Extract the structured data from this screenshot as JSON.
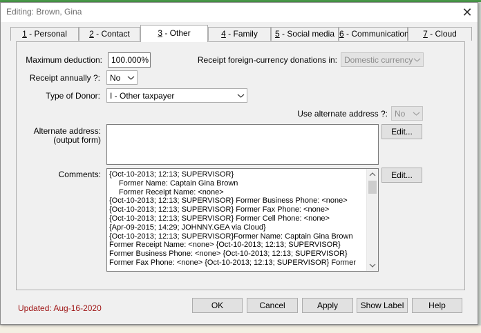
{
  "window": {
    "title": "Editing: Brown, Gina"
  },
  "tabs": [
    {
      "num": "1",
      "label": " - Personal"
    },
    {
      "num": "2",
      "label": " - Contact"
    },
    {
      "num": "3",
      "label": " - Other",
      "active": true
    },
    {
      "num": "4",
      "label": " - Family"
    },
    {
      "num": "5",
      "label": " - Social media"
    },
    {
      "num": "6",
      "label": " - Communication"
    },
    {
      "num": "7",
      "label": " - Cloud"
    }
  ],
  "form": {
    "max_deduction_label": "Maximum deduction:",
    "max_deduction_value": "100.000%",
    "foreign_label": "Receipt foreign-currency donations in:",
    "foreign_value": "Domestic currency",
    "receipt_annually_label": "Receipt annually ?:",
    "receipt_annually_value": "No",
    "donor_type_label": "Type of Donor:",
    "donor_type_value": "I - Other taxpayer",
    "alt_address_use_label": "Use alternate address ?:",
    "alt_address_use_value": "No",
    "alt_address_label_1": "Alternate address:",
    "alt_address_label_2": "(output form)",
    "alt_address_value": "",
    "edit_label": "Edit...",
    "comments_label": "Comments:",
    "comments": [
      "{Oct-10-2013; 12:13; SUPERVISOR}",
      "Former Name: Captain Gina Brown",
      "Former Receipt Name: <none>",
      "{Oct-10-2013; 12:13; SUPERVISOR}  Former Business Phone: <none>",
      "{Oct-10-2013; 12:13; SUPERVISOR}  Former Fax Phone: <none>",
      "{Oct-10-2013; 12:13; SUPERVISOR}  Former Cell Phone: <none>",
      "{Apr-09-2015; 14:29; JOHNNY.GEA via Cloud}",
      "{Oct-10-2013; 12:13; SUPERVISOR}Former Name: Captain Gina Brown",
      "Former Receipt Name: <none> {Oct-10-2013; 12:13; SUPERVISOR}",
      "Former Business Phone: <none> {Oct-10-2013; 12:13; SUPERVISOR}",
      "Former Fax Phone: <none> {Oct-10-2013; 12:13; SUPERVISOR}  Former"
    ]
  },
  "footer": {
    "updated": "Updated: Aug-16-2020",
    "ok": "OK",
    "cancel": "Cancel",
    "apply": "Apply",
    "show_label": "Show Label",
    "help": "Help"
  },
  "colors": {
    "updated_text": "#a01818",
    "title_text": "#6e6e6e",
    "dialog_bg": "#f0f0f0",
    "button_bg": "#e1e1e1"
  }
}
